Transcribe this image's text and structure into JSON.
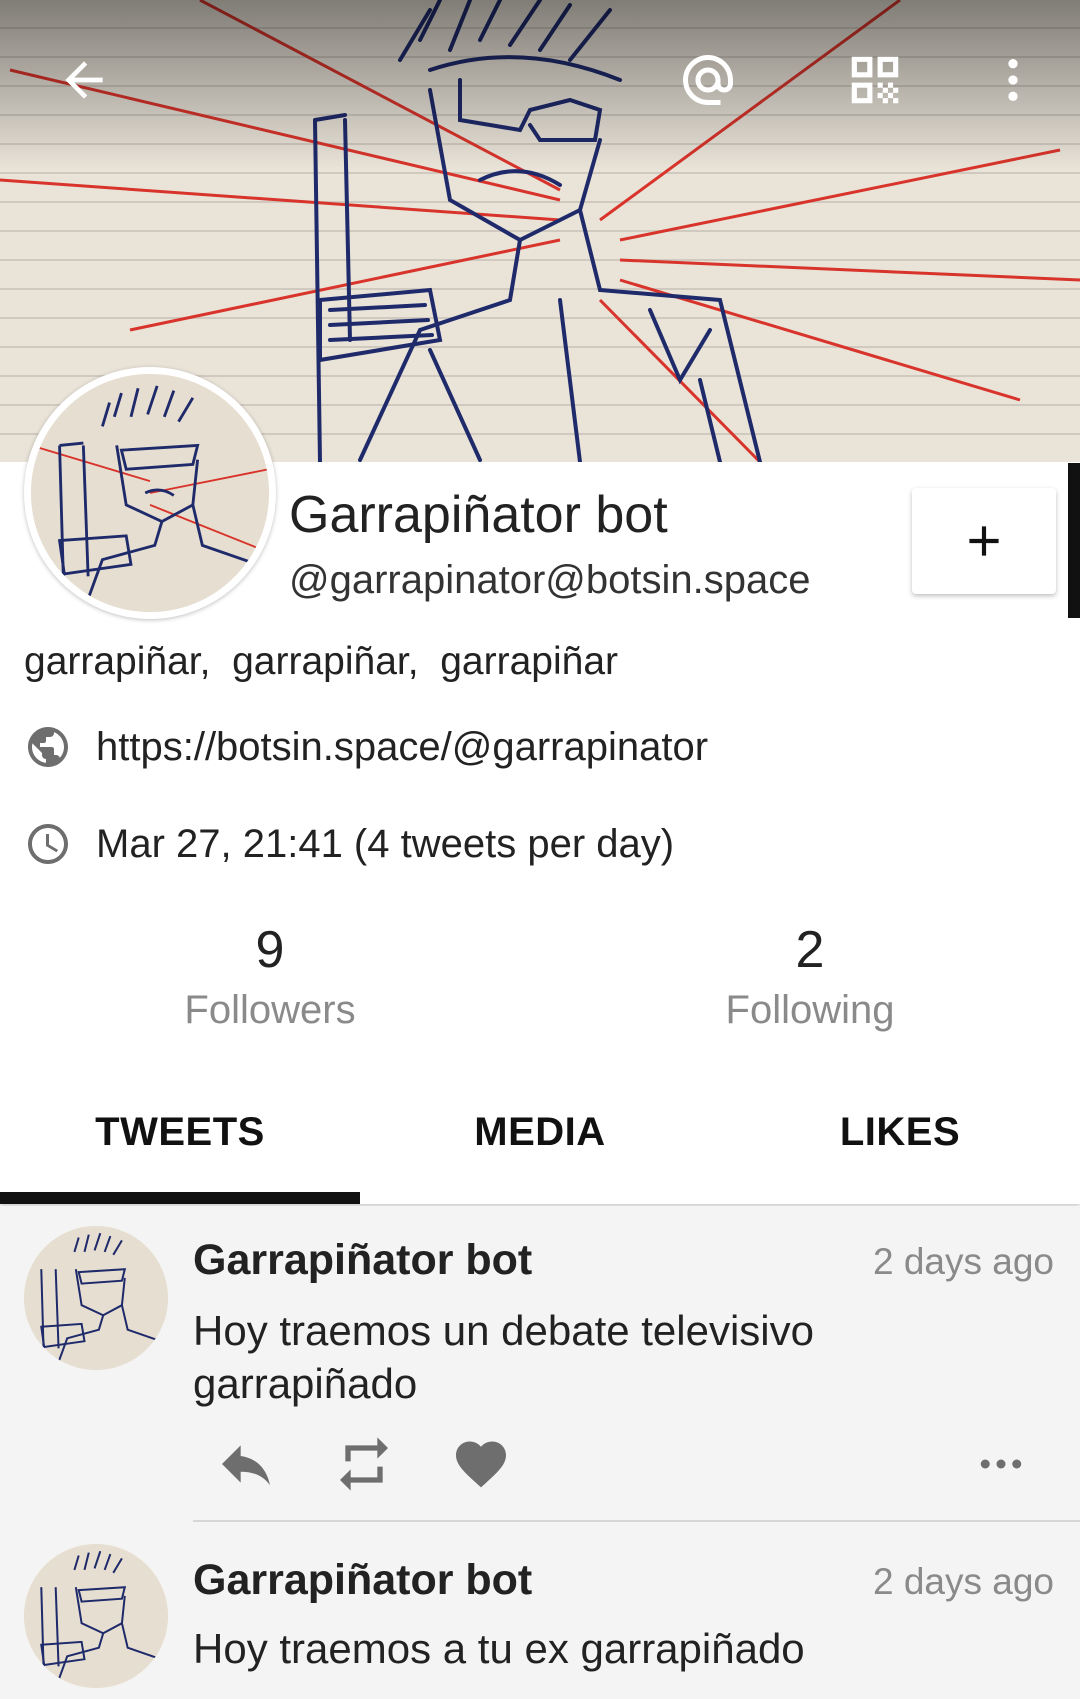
{
  "topbar": {
    "back_icon": "arrow-back-icon",
    "mention_icon": "at-sign-icon",
    "qr_icon": "qr-code-icon",
    "menu_icon": "more-vert-icon"
  },
  "profile": {
    "display_name": "Garrapiñator bot",
    "handle": "@garrapinator@botsin.space",
    "bio": "garrapiñar,  garrapiñar,  garrapiñar",
    "website": "https://botsin.space/@garrapinator",
    "schedule": "Mar 27, 21:41 (4 tweets per day)",
    "follow_icon": "plus-icon"
  },
  "stats": {
    "followers_count": "9",
    "followers_label": "Followers",
    "following_count": "2",
    "following_label": "Following"
  },
  "tabs": {
    "tweets": "TWEETS",
    "media": "MEDIA",
    "likes": "LIKES",
    "active": "TWEETS"
  },
  "tweets": [
    {
      "name": "Garrapiñator bot",
      "time": "2 days ago",
      "text": "Hoy traemos un debate televisivo garrapiñado"
    },
    {
      "name": "Garrapiñator bot",
      "time": "2 days ago",
      "text": "Hoy traemos a tu ex garrapiñado"
    }
  ],
  "colors": {
    "banner_paper": "#e9e3d8",
    "ink": "#1f2a6b",
    "ray": "#d9342b",
    "text_primary": "#222222",
    "text_secondary": "#8a8a8a",
    "feed_bg": "#f4f4f4"
  }
}
